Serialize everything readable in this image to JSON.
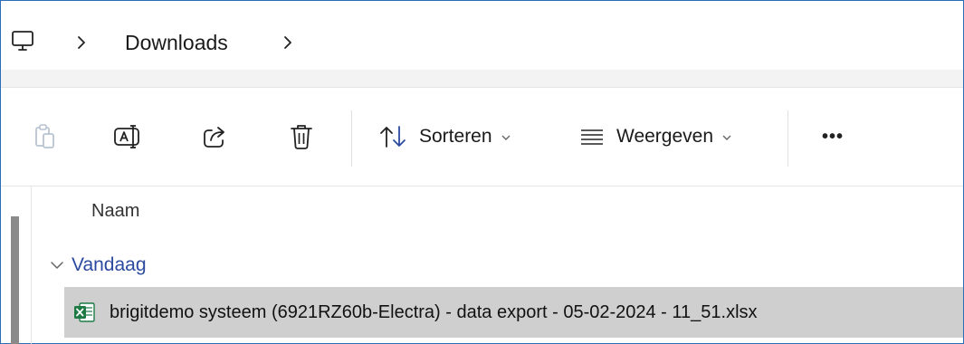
{
  "addressbar": {
    "pc_icon": "computer-monitor-icon",
    "crumb": "Downloads",
    "chevron_icon": "chevron-right-icon"
  },
  "toolbar": {
    "paste_icon": "paste-icon",
    "rename_icon": "rename-icon",
    "share_icon": "share-icon",
    "delete_icon": "trash-icon",
    "sort_icon": "sort-arrows-icon",
    "sort_label": "Sorteren",
    "view_icon": "view-lines-icon",
    "view_label": "Weergeven",
    "more_label": "•••"
  },
  "list": {
    "column_name": "Naam",
    "groups": [
      {
        "label": "Vandaag",
        "items": [
          {
            "icon": "excel-file-icon",
            "name": "brigitdemo systeem (6921RZ60b-Electra) - data export - 05-02-2024 - 11_51.xlsx"
          }
        ]
      }
    ]
  },
  "colors": {
    "frame_border": "#2d6fb6",
    "group_label": "#2b4aa0",
    "selected_row": "#cfcfcf",
    "excel_green": "#1d7a45"
  }
}
